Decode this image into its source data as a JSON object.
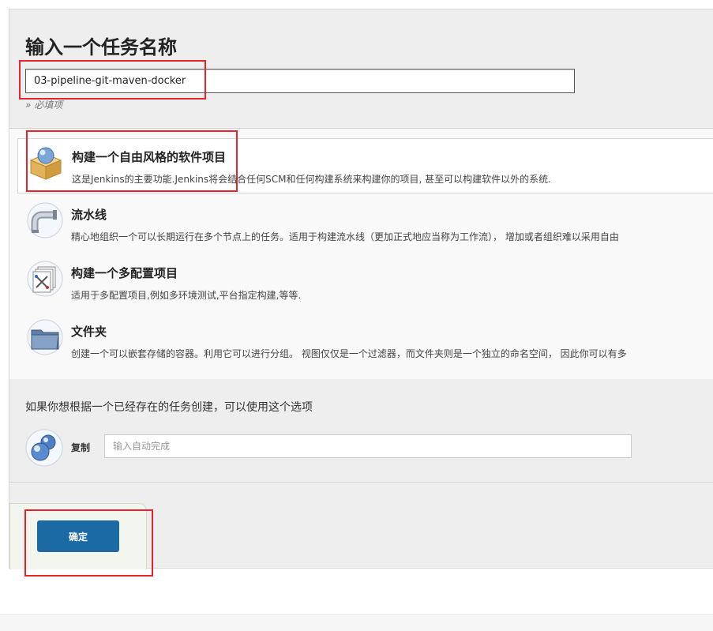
{
  "page": {
    "title": "输入一个任务名称",
    "name_value": "03-pipeline-git-maven-docker",
    "required_hint": "» 必填项"
  },
  "item_types": [
    {
      "label": "构建一个自由风格的软件项目",
      "description": "这是Jenkins的主要功能.Jenkins将会结合任何SCM和任何构建系统来构建你的项目, 甚至可以构建软件以外的系统.",
      "icon": "freestyle-box-icon",
      "selected": true
    },
    {
      "label": "流水线",
      "description": "精心地组织一个可以长期运行在多个节点上的任务。适用于构建流水线（更加正式地应当称为工作流）， 增加或者组织难以采用自由",
      "icon": "pipeline-icon",
      "selected": false
    },
    {
      "label": "构建一个多配置项目",
      "description": "适用于多配置项目,例如多环境测试,平台指定构建,等等.",
      "icon": "multi-config-icon",
      "selected": false
    },
    {
      "label": "文件夹",
      "description": "创建一个可以嵌套存储的容器。利用它可以进行分组。 视图仅仅是一个过滤器，而文件夹则是一个独立的命名空间， 因此你可以有多",
      "icon": "folder-icon",
      "selected": false
    }
  ],
  "copy": {
    "heading": "如果你想根据一个已经存在的任务创建，可以使用这个选项",
    "label": "复制",
    "placeholder": "输入自动完成",
    "icon": "copy-spheres-icon"
  },
  "actions": {
    "ok_label": "确定",
    "ok_color": "#1b6aa3"
  },
  "annotation_color": "#e8242b"
}
